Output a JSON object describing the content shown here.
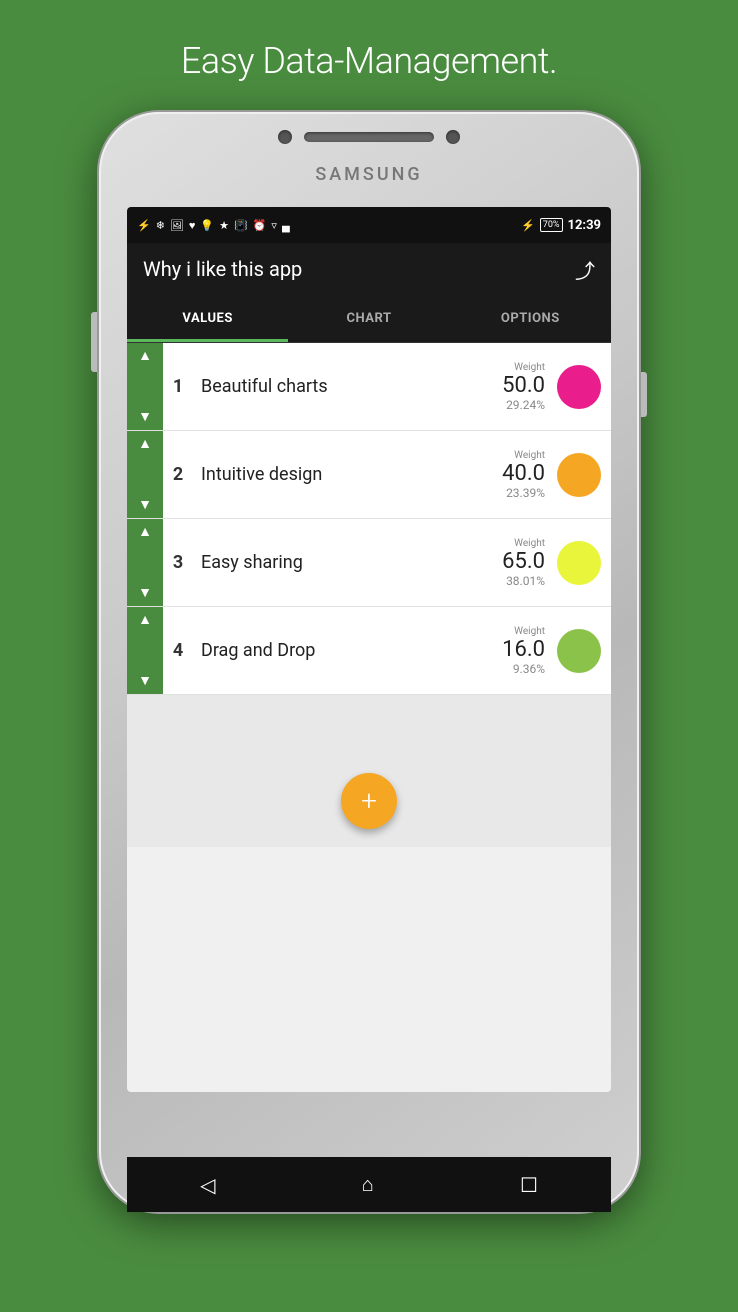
{
  "page": {
    "headline": "Easy Data-Management.",
    "samsung_label": "SAMSUNG"
  },
  "status_bar": {
    "time": "12:39",
    "battery": "70%",
    "icons": [
      "⚡",
      "📶",
      "🔋"
    ]
  },
  "app_bar": {
    "title": "Why i like this app",
    "share_icon": "share"
  },
  "tabs": [
    {
      "id": "values",
      "label": "VALUES",
      "active": true
    },
    {
      "id": "chart",
      "label": "CHART",
      "active": false
    },
    {
      "id": "options",
      "label": "OPTIONS",
      "active": false
    }
  ],
  "rows": [
    {
      "number": "1",
      "label": "Beautiful charts",
      "weight_label": "Weight",
      "weight_value": "50.0",
      "weight_percent": "29.24%",
      "color": "#e91e8c"
    },
    {
      "number": "2",
      "label": "Intuitive design",
      "weight_label": "Weight",
      "weight_value": "40.0",
      "weight_percent": "23.39%",
      "color": "#f5a623"
    },
    {
      "number": "3",
      "label": "Easy sharing",
      "weight_label": "Weight",
      "weight_value": "65.0",
      "weight_percent": "38.01%",
      "color": "#e8f53a"
    },
    {
      "number": "4",
      "label": "Drag and Drop",
      "weight_label": "Weight",
      "weight_value": "16.0",
      "weight_percent": "9.36%",
      "color": "#8bc34a"
    }
  ],
  "fab": {
    "label": "+"
  },
  "nav": {
    "back": "◁",
    "home": "⌂",
    "recent": "☐"
  }
}
